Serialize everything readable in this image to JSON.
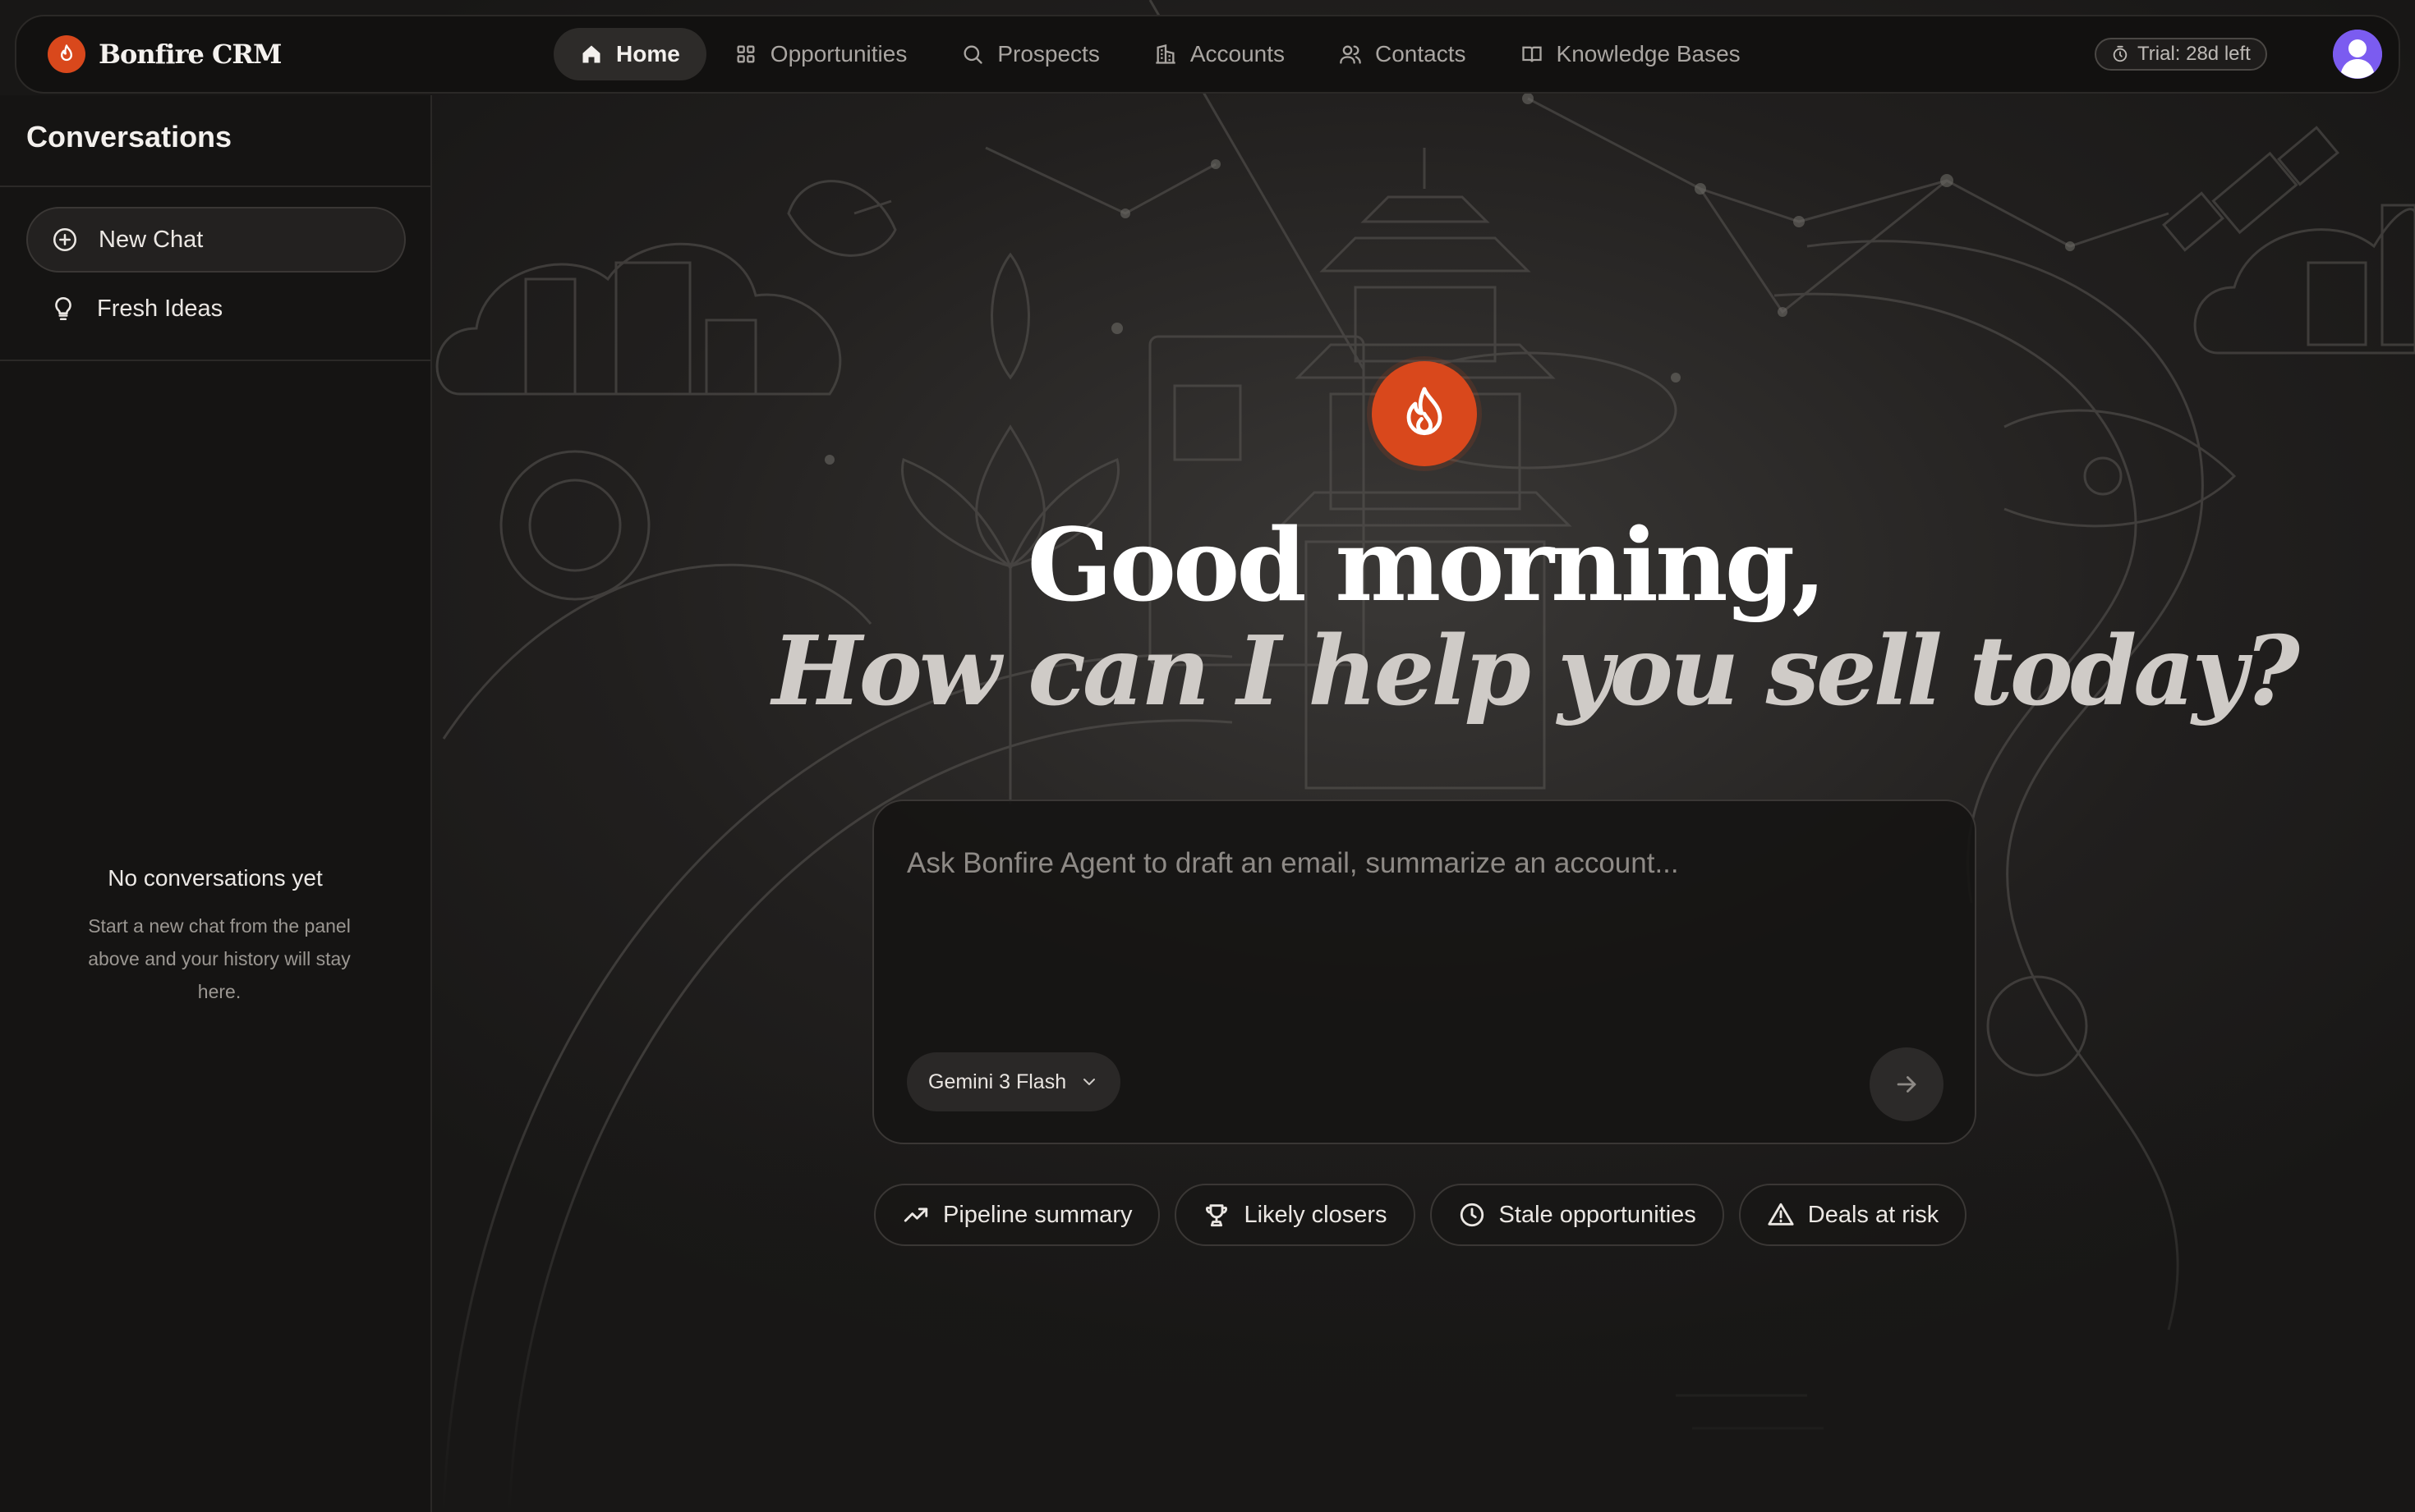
{
  "app": {
    "brand_name": "Bonfire CRM",
    "accent_color": "#d9481c"
  },
  "nav": {
    "items": [
      {
        "label": "Home",
        "icon": "home-icon",
        "active": true
      },
      {
        "label": "Opportunities",
        "icon": "grid-icon",
        "active": false
      },
      {
        "label": "Prospects",
        "icon": "search-icon",
        "active": false
      },
      {
        "label": "Accounts",
        "icon": "building-icon",
        "active": false
      },
      {
        "label": "Contacts",
        "icon": "users-icon",
        "active": false
      },
      {
        "label": "Knowledge Bases",
        "icon": "book-icon",
        "active": false
      }
    ],
    "trial_label": "Trial: 28d left",
    "trial_icon": "timer-icon",
    "avatar_icon": "user-avatar-icon"
  },
  "sidebar": {
    "title": "Conversations",
    "items": [
      {
        "label": "New Chat",
        "icon": "plus-circle-icon"
      },
      {
        "label": "Fresh Ideas",
        "icon": "lightbulb-icon"
      }
    ],
    "empty_title": "No conversations yet",
    "empty_description": "Start a new chat from the panel above and your history will stay here."
  },
  "hero": {
    "logo_icon": "flame-icon",
    "greeting": "Good morning,",
    "subgreeting": "How can I help you sell today?"
  },
  "composer": {
    "placeholder": "Ask Bonfire Agent to draft an email, summarize an account...",
    "value": "",
    "model_label": "Gemini 3 Flash",
    "model_icon": "chevron-down-icon",
    "send_icon": "arrow-right-icon"
  },
  "suggestions": [
    {
      "label": "Pipeline summary",
      "icon": "trending-up-icon"
    },
    {
      "label": "Likely closers",
      "icon": "trophy-icon"
    },
    {
      "label": "Stale opportunities",
      "icon": "clock-icon"
    },
    {
      "label": "Deals at risk",
      "icon": "warning-triangle-icon"
    }
  ]
}
